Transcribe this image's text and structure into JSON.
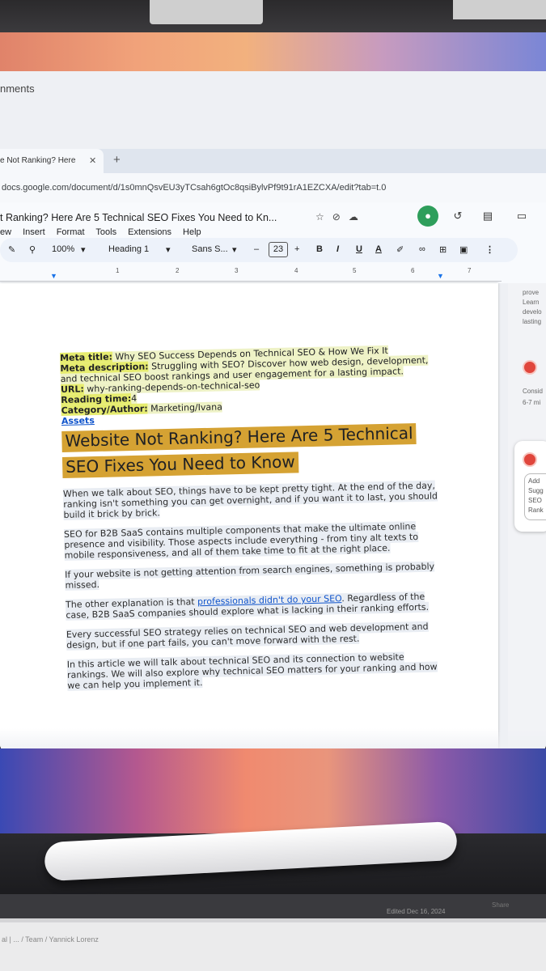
{
  "browser": {
    "comments_label": "nments",
    "tab_title": "e Not Ranking? Here",
    "tab_close": "✕",
    "tab_new": "+",
    "url": "docs.google.com/document/d/1s0mnQsvEU3yTCsah6gtOc8qsiBylvPf9t91rA1EZCXA/edit?tab=t.0"
  },
  "doc_header": {
    "title": "t Ranking? Here Are 5 Technical SEO Fixes You Need to Kn...",
    "title_icons": [
      "star-icon",
      "move-icon",
      "cloud-icon"
    ],
    "menu": [
      "ew",
      "Insert",
      "Format",
      "Tools",
      "Extensions",
      "Help"
    ]
  },
  "toolbar": {
    "zoom": "100%",
    "style": "Heading 1",
    "font": "Sans S...",
    "minus": "–",
    "font_size": "23",
    "plus": "+",
    "bold": "B",
    "italic": "I",
    "underline": "U",
    "text_color": "A",
    "more": "⋮"
  },
  "ruler": [
    "1",
    "2",
    "3",
    "4",
    "5",
    "6",
    "7"
  ],
  "document": {
    "meta_title_label": "Meta title:",
    "meta_title_value": " Why SEO Success Depends on Technical SEO & How We Fix It",
    "meta_desc_label": "Meta description:",
    "meta_desc_value": " Struggling with SEO? Discover how web design, development, and technical SEO boost rankings and user engagement for a lasting impact.",
    "url_label": "URL:",
    "url_value": " why-ranking-depends-on-technical-seo",
    "reading_label": "Reading time:",
    "reading_value": "4",
    "category_label": "Category/Author:",
    "category_value": " Marketing/Ivana",
    "assets": "Assets",
    "heading_line1": "Website Not Ranking? Here Are 5 Technical",
    "heading_line2": "SEO Fixes You Need to Know",
    "p1": "When we talk about SEO, things have to be kept pretty tight. At the end of the day, ranking isn't something you can get overnight, and if you want it to last, you should build it brick by brick.",
    "p2": "SEO for B2B SaaS contains multiple components that make the ultimate online presence and visibility. Those aspects include everything - from tiny alt texts to mobile responsiveness, and all of them take time to fit at the right place.",
    "p3": "If your website is not getting attention from search engines, something is probably missed.",
    "p4_before": "The other explanation is that ",
    "p4_link": "professionals didn't do your SEO",
    "p4_after": ". Regardless of the case, B2B SaaS companies should explore what is lacking in their ranking efforts.",
    "p5": "Every successful SEO strategy relies on technical SEO and web development and design, but if one part fails, you can't move forward with the rest.",
    "p6": "In this article we will talk about technical SEO and its connection to website rankings. We will also explore why technical SEO matters for your ranking and how we can help you implement it."
  },
  "side_panel": {
    "snippet_lines": [
      "prove",
      "Learn",
      "develo",
      "lasting"
    ],
    "consider_lines": [
      "Consid",
      "6-7 mi"
    ],
    "card_lines": [
      "Add",
      "Sugg",
      "SEO",
      "Rank"
    ]
  },
  "status": {
    "crumbs": "al | ... / Team /  Yannick Lorenz",
    "edited": "Edited Dec 16, 2024",
    "share": "Share"
  },
  "colors": {
    "heading_highlight": "#d5a233",
    "meta_highlight": "#e6ec6f",
    "link": "#1155cc",
    "avatar": "#e0463c"
  }
}
